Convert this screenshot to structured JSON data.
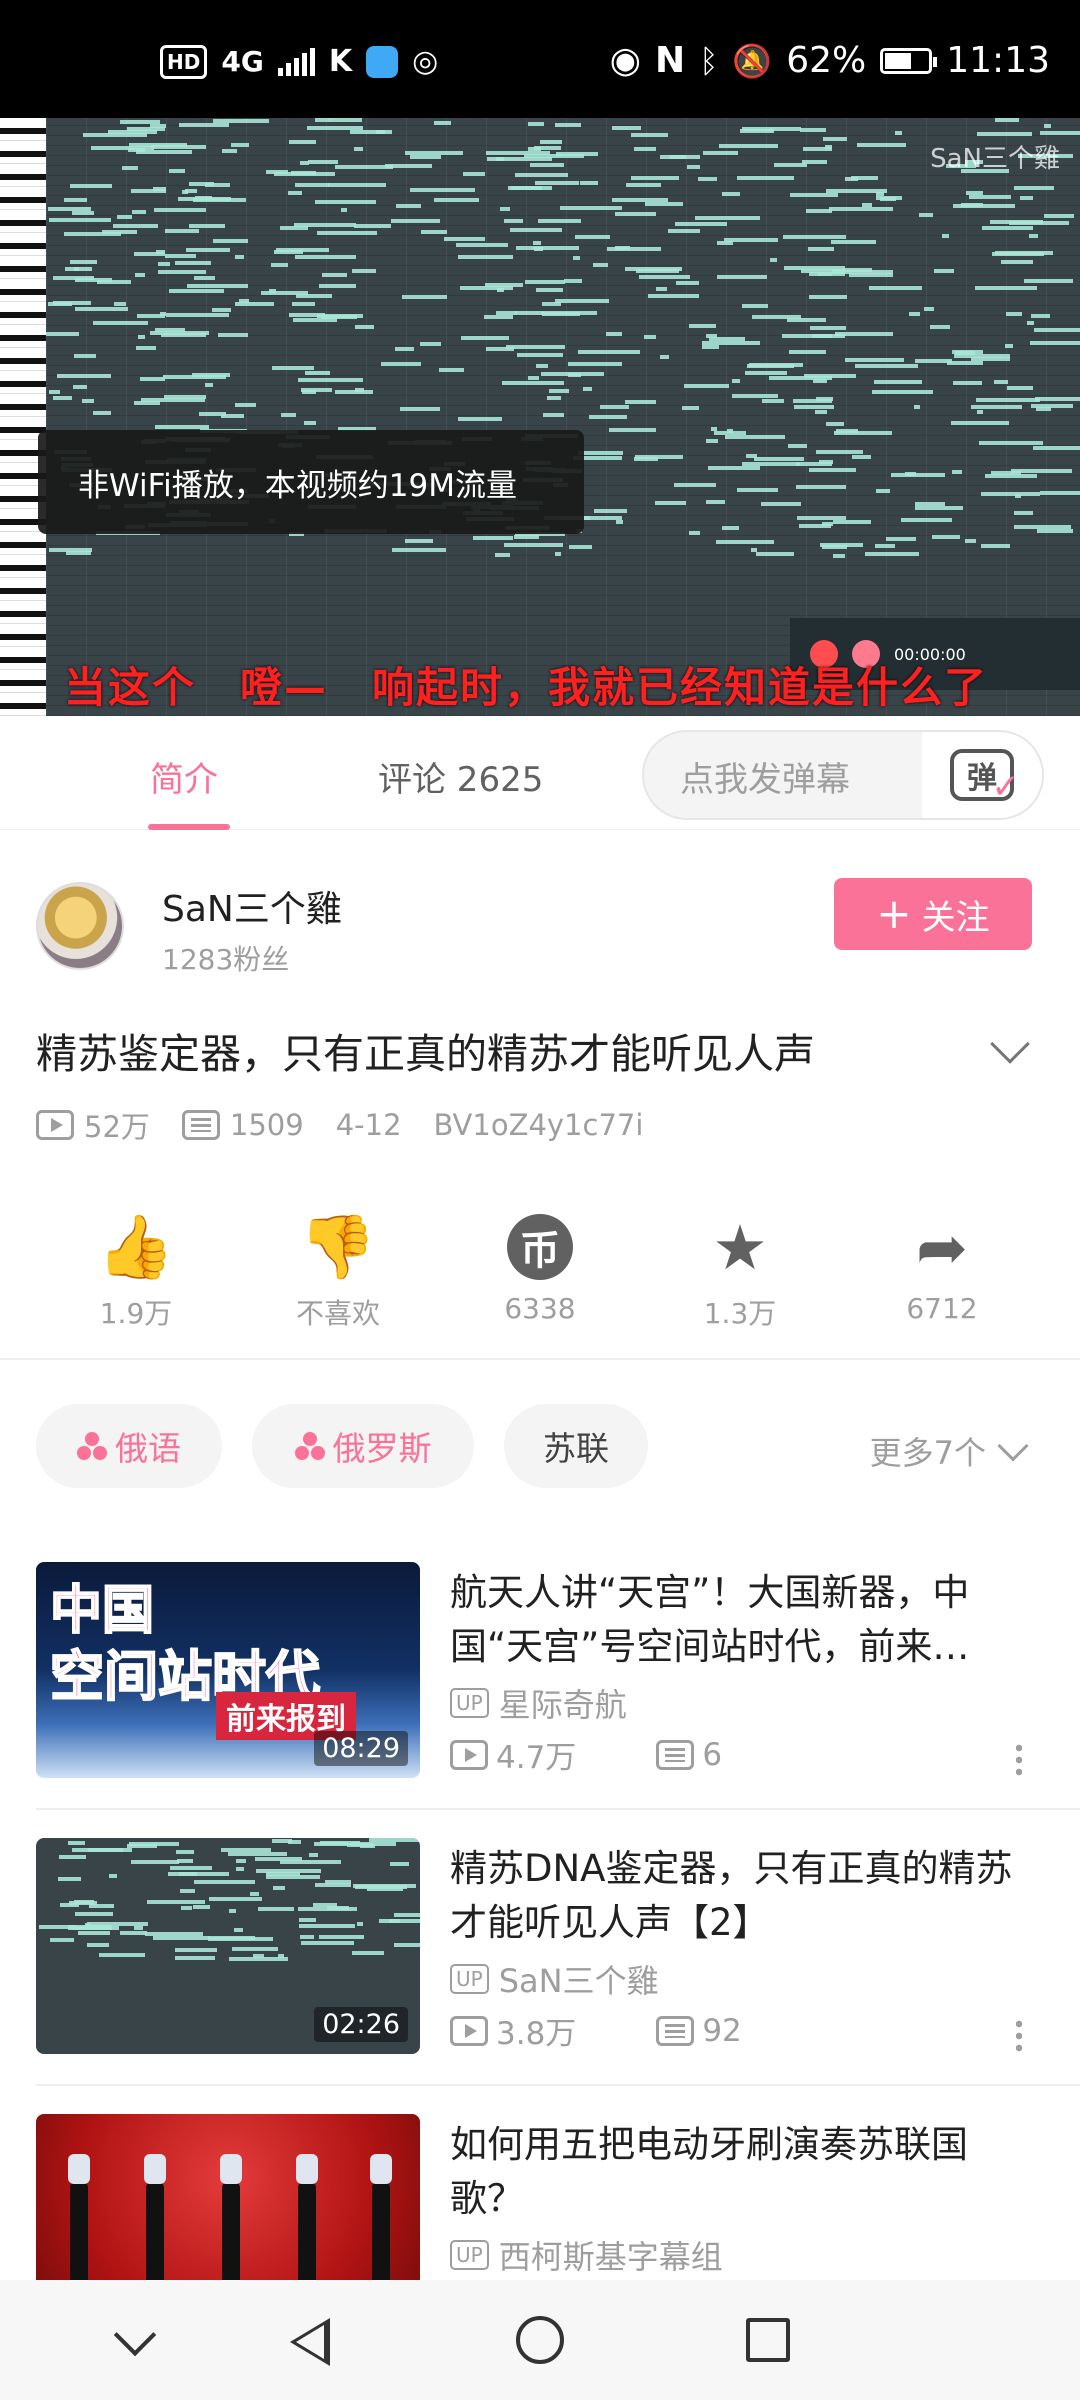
{
  "status_bar": {
    "left_badge": "HD",
    "net_type": "4G",
    "battery_percent": "62%",
    "battery_level": 0.62,
    "time": "11:13"
  },
  "video": {
    "watermark": "SaN三个雞",
    "toast": "非WiFi播放，本视频约19M流量",
    "mini_time": "00:00:00",
    "subtitle": "当这个　噔—　响起时，我就已经知道是什么了"
  },
  "tabs": {
    "intro": "简介",
    "comments": "评论 2625",
    "danmaku_placeholder": "点我发弹幕",
    "danmaku_icon_glyph": "弹"
  },
  "uploader": {
    "name": "SaN三个雞",
    "fans": "1283粉丝",
    "follow_label": "关注",
    "follow_plus": "+"
  },
  "video_info": {
    "title": "精苏鉴定器，只有正真的精苏才能听见人声",
    "views": "52万",
    "danmaku_count": "1509",
    "date": "4-12",
    "bvid": "BV1oZ4y1c77i"
  },
  "actions": {
    "like": "1.9万",
    "dislike": "不喜欢",
    "coin": "6338",
    "coin_glyph": "币",
    "favorite": "1.3万",
    "share": "6712"
  },
  "tags": {
    "items": [
      "俄语",
      "俄罗斯",
      "苏联"
    ],
    "more": "更多7个"
  },
  "related": [
    {
      "title": "航天人讲“天宫”！大国新器，中国“天宫”号空间站时代，前来…",
      "up_badge": "UP",
      "uploader": "星际奇航",
      "views": "4.7万",
      "danmaku": "6",
      "duration": "08:29",
      "thumb_text_1": "中国",
      "thumb_text_2": "空间站时代",
      "thumb_text_3": "前来报到"
    },
    {
      "title": "精苏DNA鉴定器，只有正真的精苏才能听见人声【2】",
      "up_badge": "UP",
      "uploader": "SaN三个雞",
      "views": "3.8万",
      "danmaku": "92",
      "duration": "02:26"
    },
    {
      "title": "如何用五把电动牙刷演奏苏联国歌？",
      "up_badge": "UP",
      "uploader": "西柯斯基字幕组"
    }
  ]
}
